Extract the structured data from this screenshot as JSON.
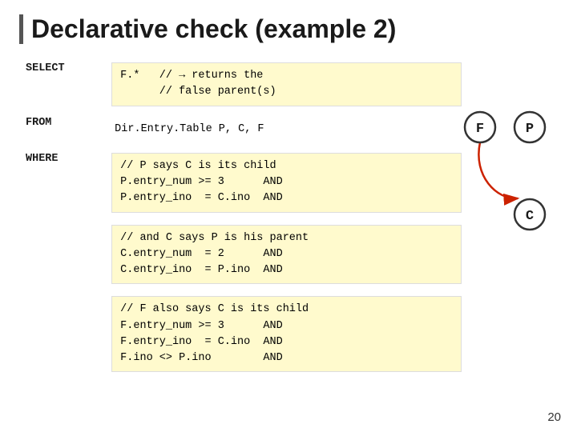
{
  "title": "Declarative check (example 2)",
  "rows": [
    {
      "keyword": "SELECT",
      "code": "F.*   // → returns the\n      // false parent(s)",
      "style": "block"
    },
    {
      "keyword": "FROM",
      "code": "Dir.Entry.Table P, C, F",
      "style": "plain"
    },
    {
      "keyword": "WHERE",
      "code": "// P says C is its child\nP.entry_num >= 3      AND\nP.entry_ino  = C.ino  AND",
      "style": "block"
    },
    {
      "keyword": "",
      "code": "// and C says P is his parent\nC.entry_num  = 2      AND\nC.entry_ino  = P.ino  AND",
      "style": "block"
    },
    {
      "keyword": "",
      "code": "// F also says C is its child\nF.entry_num >= 3      AND\nF.entry_ino  = C.ino  AND\nF.ino <> P.ino        AND",
      "style": "block"
    }
  ],
  "diagram": {
    "nodes": [
      "F",
      "P",
      "C"
    ],
    "arrow_label": ""
  },
  "page_number": "20"
}
